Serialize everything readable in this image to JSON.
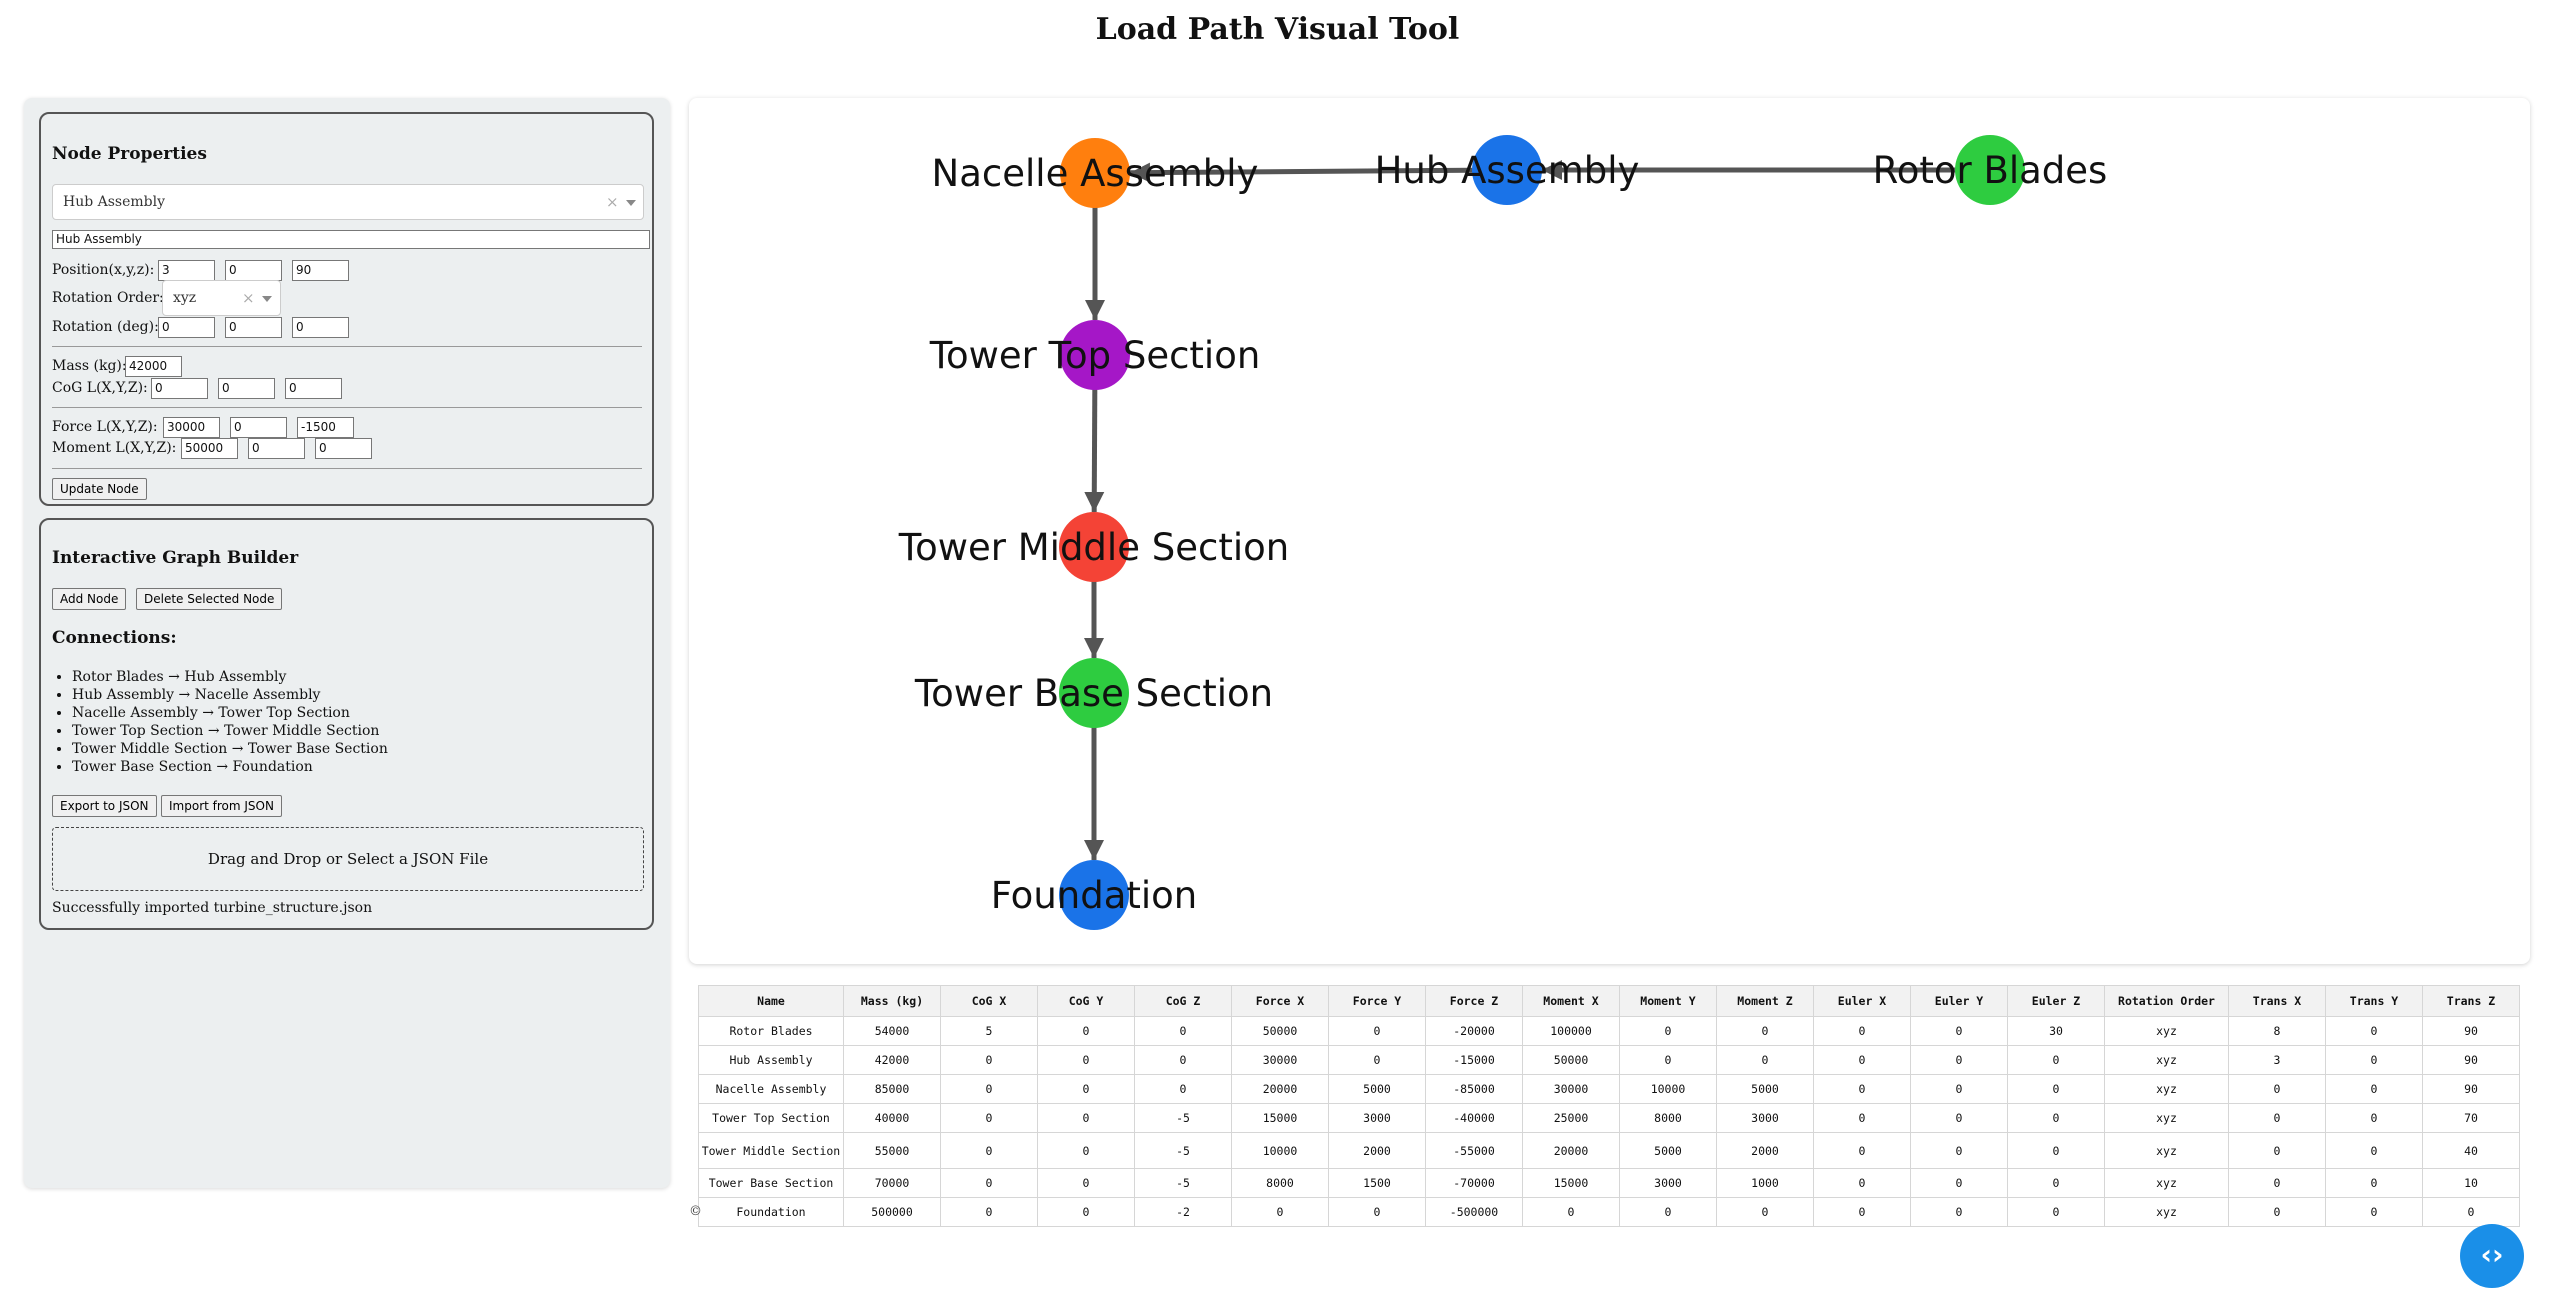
{
  "title": "Load Path Visual Tool",
  "node_properties": {
    "heading": "Node Properties",
    "selected_node": "Hub Assembly",
    "name_value": "Hub Assembly",
    "position_label": "Position(x,y,z):",
    "position": [
      "3",
      "0",
      "90"
    ],
    "rotation_order_label": "Rotation Order:",
    "rotation_order": "xyz",
    "rotation_label": "Rotation (deg):",
    "rotation": [
      "0",
      "0",
      "0"
    ],
    "mass_label": "Mass (kg):",
    "mass": "42000",
    "cog_label": "CoG L(X,Y,Z):",
    "cog": [
      "0",
      "0",
      "0"
    ],
    "force_label": "Force L(X,Y,Z):",
    "force": [
      "30000",
      "0",
      "-1500"
    ],
    "moment_label": "Moment L(X,Y,Z):",
    "moment": [
      "50000",
      "0",
      "0"
    ],
    "update_button": "Update Node",
    "clear_glyph": "×"
  },
  "graph_builder": {
    "heading": "Interactive Graph Builder",
    "add_button": "Add Node",
    "delete_button": "Delete Selected Node",
    "connections_heading": "Connections:",
    "connections": [
      "Rotor Blades → Hub Assembly",
      "Hub Assembly → Nacelle Assembly",
      "Nacelle Assembly → Tower Top Section",
      "Tower Top Section → Tower Middle Section",
      "Tower Middle Section → Tower Base Section",
      "Tower Base Section → Foundation"
    ],
    "export_button": "Export to JSON",
    "import_button": "Import from JSON",
    "dropzone_text": "Drag and Drop or Select a JSON File",
    "status": "Successfully imported turbine_structure.json"
  },
  "graph": {
    "nodes": [
      {
        "id": "Nacelle Assembly",
        "color": "#ff7f0e"
      },
      {
        "id": "Hub Assembly",
        "color": "#1a73e8"
      },
      {
        "id": "Rotor Blades",
        "color": "#2ecc40"
      },
      {
        "id": "Tower Top Section",
        "color": "#a517c7"
      },
      {
        "id": "Tower Middle Section",
        "color": "#f44336"
      },
      {
        "id": "Tower Base Section",
        "color": "#2ecc40"
      },
      {
        "id": "Foundation",
        "color": "#1a73e8"
      }
    ],
    "edges": [
      [
        "Rotor Blades",
        "Hub Assembly"
      ],
      [
        "Hub Assembly",
        "Nacelle Assembly"
      ],
      [
        "Nacelle Assembly",
        "Tower Top Section"
      ],
      [
        "Tower Top Section",
        "Tower Middle Section"
      ],
      [
        "Tower Middle Section",
        "Tower Base Section"
      ],
      [
        "Tower Base Section",
        "Foundation"
      ]
    ],
    "edge_color": "#555555"
  },
  "table": {
    "columns": [
      "Name",
      "Mass (kg)",
      "CoG X",
      "CoG Y",
      "CoG Z",
      "Force X",
      "Force Y",
      "Force Z",
      "Moment X",
      "Moment Y",
      "Moment Z",
      "Euler X",
      "Euler Y",
      "Euler Z",
      "Rotation Order",
      "Trans X",
      "Trans Y",
      "Trans Z"
    ],
    "rows": [
      [
        "Rotor Blades",
        "54000",
        "5",
        "0",
        "0",
        "50000",
        "0",
        "-20000",
        "100000",
        "0",
        "0",
        "0",
        "0",
        "30",
        "xyz",
        "8",
        "0",
        "90"
      ],
      [
        "Hub Assembly",
        "42000",
        "0",
        "0",
        "0",
        "30000",
        "0",
        "-15000",
        "50000",
        "0",
        "0",
        "0",
        "0",
        "0",
        "xyz",
        "3",
        "0",
        "90"
      ],
      [
        "Nacelle Assembly",
        "85000",
        "0",
        "0",
        "0",
        "20000",
        "5000",
        "-85000",
        "30000",
        "10000",
        "5000",
        "0",
        "0",
        "0",
        "xyz",
        "0",
        "0",
        "90"
      ],
      [
        "Tower Top Section",
        "40000",
        "0",
        "0",
        "-5",
        "15000",
        "3000",
        "-40000",
        "25000",
        "8000",
        "3000",
        "0",
        "0",
        "0",
        "xyz",
        "0",
        "0",
        "70"
      ],
      [
        "Tower Middle Section",
        "55000",
        "0",
        "0",
        "-5",
        "10000",
        "2000",
        "-55000",
        "20000",
        "5000",
        "2000",
        "0",
        "0",
        "0",
        "xyz",
        "0",
        "0",
        "40"
      ],
      [
        "Tower Base Section",
        "70000",
        "0",
        "0",
        "-5",
        "8000",
        "1500",
        "-70000",
        "15000",
        "3000",
        "1000",
        "0",
        "0",
        "0",
        "xyz",
        "0",
        "0",
        "10"
      ],
      [
        "Foundation",
        "500000",
        "0",
        "0",
        "-2",
        "0",
        "0",
        "-500000",
        "0",
        "0",
        "0",
        "0",
        "0",
        "0",
        "xyz",
        "0",
        "0",
        "0"
      ]
    ]
  },
  "copyright_glyph": "©",
  "fab_icon": "‹›"
}
